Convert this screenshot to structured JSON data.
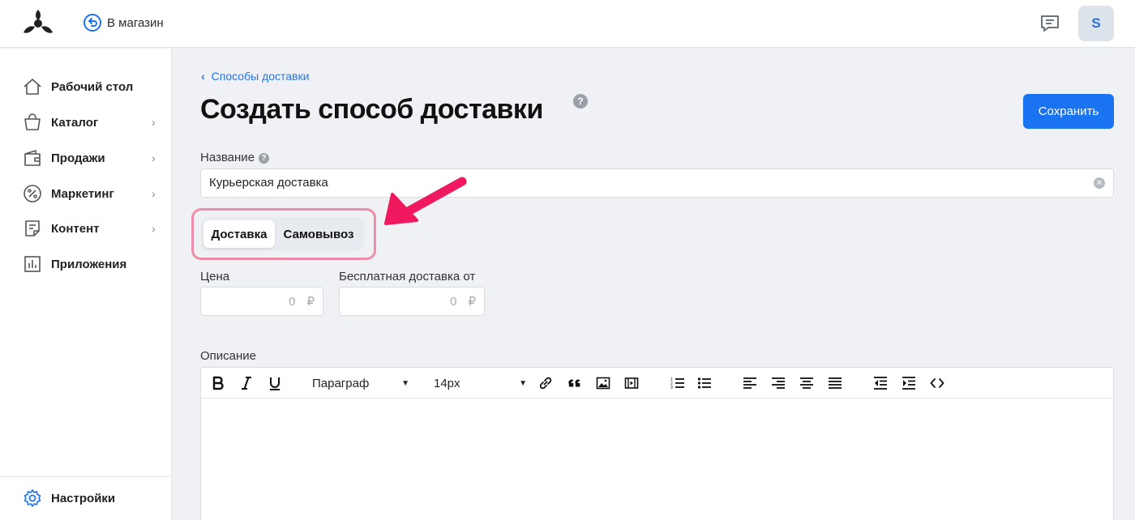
{
  "header": {
    "store_link_label": "В магазин",
    "avatar_initial": "S"
  },
  "sidebar": {
    "items": [
      {
        "label": "Рабочий стол",
        "icon": "home-icon",
        "has_children": false
      },
      {
        "label": "Каталог",
        "icon": "shopping-bag-icon",
        "has_children": true
      },
      {
        "label": "Продажи",
        "icon": "wallet-icon",
        "has_children": true
      },
      {
        "label": "Маркетинг",
        "icon": "percent-icon",
        "has_children": true
      },
      {
        "label": "Контент",
        "icon": "document-icon",
        "has_children": true
      },
      {
        "label": "Приложения",
        "icon": "bar-chart-icon",
        "has_children": false
      }
    ],
    "footer": {
      "label": "Настройки",
      "icon": "gear-icon"
    }
  },
  "main": {
    "breadcrumb": "Способы доставки",
    "title": "Создать способ доставки",
    "save_label": "Сохранить",
    "name_label": "Название",
    "name_value": "Курьерская доставка",
    "tabs": [
      {
        "label": "Доставка",
        "active": true
      },
      {
        "label": "Самовывоз",
        "active": false
      }
    ],
    "price_label": "Цена",
    "price_value": "0",
    "free_label": "Бесплатная доставка от",
    "free_value": "0",
    "currency": "₽",
    "description_label": "Описание",
    "editor": {
      "block_format": "Параграф",
      "font_size": "14px",
      "tools": [
        "bold-icon",
        "italic-icon",
        "underline-icon",
        "link-icon",
        "quote-icon",
        "image-icon",
        "video-icon",
        "ordered-list-icon",
        "bullet-list-icon",
        "align-left-icon",
        "align-right-icon",
        "align-center-icon",
        "align-justify-icon",
        "outdent-icon",
        "indent-icon",
        "code-icon"
      ]
    }
  },
  "colors": {
    "accent": "#1a73f0",
    "highlight": "#ef8ca7",
    "arrow": "#f0185e"
  }
}
